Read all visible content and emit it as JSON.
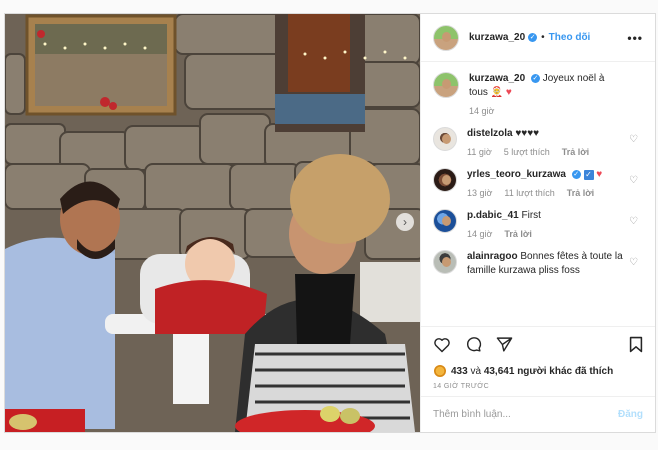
{
  "post": {
    "author": "kurzawa_20",
    "follow_label": "Theo dõi",
    "more_label": "•••",
    "caption_author": "kurzawa_20",
    "caption_text": "Joyeux noël à tous 🤶",
    "caption_heart": "♥",
    "caption_time": "14 giờ"
  },
  "comments": [
    {
      "user": "distelzola",
      "text": "♥♥♥♥",
      "time": "11 giờ",
      "likes": "5 lượt thích",
      "reply": "Trả lời"
    },
    {
      "user": "yrles_teoro_kurzawa",
      "text_check": "✓",
      "text_heart": "♥",
      "time": "13 giờ",
      "likes": "11 lượt thích",
      "reply": "Trả lời"
    },
    {
      "user": "p.dabic_41",
      "text": "First",
      "time": "14 giờ",
      "reply": "Trả lời"
    },
    {
      "user": "alainragoo",
      "text": "Bonnes fêtes à toute la famille kurzawa pliss foss"
    }
  ],
  "likes": {
    "count_a": "433",
    "connector": "và",
    "count_b": "43,641",
    "suffix": "người khác đã thích"
  },
  "time_ago": "14 GIỜ TRƯỚC",
  "add_comment": {
    "placeholder": "Thêm bình luận...",
    "post_label": "Đăng"
  },
  "icons": {
    "next": "chevron-right-icon",
    "like": "heart-outline-icon",
    "comment": "speech-bubble-icon",
    "share": "paper-plane-icon",
    "save": "bookmark-icon",
    "verified": "verified-badge-icon"
  },
  "colors": {
    "link_blue": "#3897f0",
    "verified_blue": "#3897f0",
    "like_red": "#ed4956",
    "muted": "#8e8e8e",
    "post_disabled": "#b2dffc"
  }
}
